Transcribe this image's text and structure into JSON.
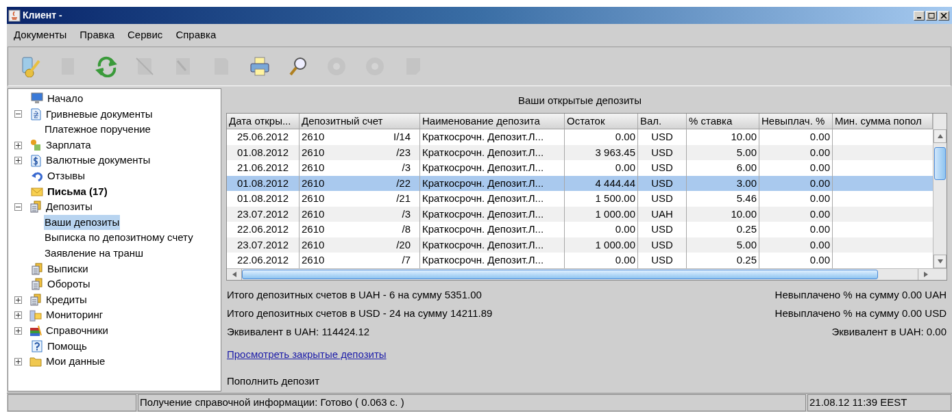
{
  "window": {
    "title": "Клиент -"
  },
  "menu": [
    "Документы",
    "Правка",
    "Сервис",
    "Справка"
  ],
  "toolbar": [
    {
      "kind": "key",
      "disabled": false
    },
    {
      "kind": "page",
      "disabled": true
    },
    {
      "kind": "refresh",
      "disabled": false
    },
    {
      "kind": "delete",
      "disabled": true
    },
    {
      "kind": "sign",
      "disabled": true
    },
    {
      "kind": "copy",
      "disabled": true
    },
    {
      "kind": "print",
      "disabled": false
    },
    {
      "kind": "search",
      "disabled": false
    },
    {
      "kind": "disc",
      "disabled": true
    },
    {
      "kind": "disc",
      "disabled": true
    },
    {
      "kind": "note",
      "disabled": true
    }
  ],
  "tree": [
    {
      "label": "Начало",
      "kind": "monitor",
      "selected": false
    },
    {
      "label": "Гривневые документы",
      "kind": "hryvnia",
      "expanded": true,
      "selected": false,
      "children": [
        {
          "label": "Платежное поручение",
          "selected": false
        }
      ]
    },
    {
      "label": "Зарплата",
      "kind": "people",
      "expanded": false,
      "selected": false
    },
    {
      "label": "Валютные документы",
      "kind": "dollar",
      "expanded": false,
      "selected": false
    },
    {
      "label": "Отзывы",
      "kind": "reply",
      "selected": false
    },
    {
      "label": "Письма (17)",
      "kind": "mail",
      "unread": true,
      "selected": false
    },
    {
      "label": "Депозиты",
      "kind": "stack",
      "expanded": true,
      "selected": false,
      "children": [
        {
          "label": "Ваши депозиты",
          "selected": true
        },
        {
          "label": "Выписка по депозитному счету",
          "selected": false
        },
        {
          "label": "Заявление на транш",
          "selected": false
        }
      ]
    },
    {
      "label": "Выписки",
      "kind": "stack",
      "selected": false
    },
    {
      "label": "Обороты",
      "kind": "stack",
      "selected": false
    },
    {
      "label": "Кредиты",
      "kind": "stack",
      "expanded": false,
      "selected": false
    },
    {
      "label": "Мониторинг",
      "kind": "monitoring",
      "expanded": false,
      "selected": false
    },
    {
      "label": "Справочники",
      "kind": "books",
      "expanded": false,
      "selected": false
    },
    {
      "label": "Помощь",
      "kind": "help",
      "selected": false
    },
    {
      "label": "Мои данные",
      "kind": "folder",
      "expanded": false,
      "selected": false
    }
  ],
  "panel_title": "Ваши открытые депозиты",
  "table": {
    "columns": [
      "Дата откры...",
      "Депозитный счет",
      "Наименование депозита",
      "Остаток",
      "Вал.",
      "% ставка",
      "Невыплач. %",
      "Мин. сумма попол"
    ],
    "rows": [
      {
        "date": "25.06.2012",
        "account": "2610",
        "account_suffix": "I/14",
        "name": "Краткосрочн. Депозит.Л...",
        "balance": "0.00",
        "currency": "USD",
        "rate": "10.00",
        "unpaid": "0.00",
        "selected": false
      },
      {
        "date": "01.08.2012",
        "account": "2610",
        "account_suffix": "/23",
        "name": "Краткосрочн. Депозит.Л...",
        "balance": "3 963.45",
        "currency": "USD",
        "rate": "5.00",
        "unpaid": "0.00",
        "selected": false
      },
      {
        "date": "21.06.2012",
        "account": "2610",
        "account_suffix": "/3",
        "name": "Краткосрочн. Депозит.Л...",
        "balance": "0.00",
        "currency": "USD",
        "rate": "6.00",
        "unpaid": "0.00",
        "selected": false
      },
      {
        "date": "01.08.2012",
        "account": "2610",
        "account_suffix": "/22",
        "name": "Краткосрочн. Депозит.Л...",
        "balance": "4 444.44",
        "currency": "USD",
        "rate": "3.00",
        "unpaid": "0.00",
        "selected": true
      },
      {
        "date": "01.08.2012",
        "account": "2610",
        "account_suffix": "/21",
        "name": "Краткосрочн. Депозит.Л...",
        "balance": "1 500.00",
        "currency": "USD",
        "rate": "5.46",
        "unpaid": "0.00",
        "selected": false
      },
      {
        "date": "23.07.2012",
        "account": "2610",
        "account_suffix": "/3",
        "name": "Краткосрочн. Депозит.Л...",
        "balance": "1 000.00",
        "currency": "UAH",
        "rate": "10.00",
        "unpaid": "0.00",
        "selected": false
      },
      {
        "date": "22.06.2012",
        "account": "2610",
        "account_suffix": "/8",
        "name": "Краткосрочн. Депозит.Л...",
        "balance": "0.00",
        "currency": "USD",
        "rate": "0.25",
        "unpaid": "0.00",
        "selected": false
      },
      {
        "date": "23.07.2012",
        "account": "2610",
        "account_suffix": "/20",
        "name": "Краткосрочн. Депозит.Л...",
        "balance": "1 000.00",
        "currency": "USD",
        "rate": "5.00",
        "unpaid": "0.00",
        "selected": false
      },
      {
        "date": "22.06.2012",
        "account": "2610",
        "account_suffix": "/7",
        "name": "Краткосрочн. Депозит.Л...",
        "balance": "0.00",
        "currency": "USD",
        "rate": "0.25",
        "unpaid": "0.00",
        "selected": false
      }
    ]
  },
  "summary": [
    {
      "left": "Итого депозитных счетов в UAH - 6 на сумму 5351.00",
      "right": "Невыплачено % на сумму 0.00 UAH"
    },
    {
      "left": "Итого депозитных счетов в USD - 24 на сумму 14211.89",
      "right": "Невыплачено % на сумму 0.00 USD"
    },
    {
      "left": "Эквивалент в UAH: 114424.12",
      "right": "Эквивалент в UAH: 0.00"
    }
  ],
  "closed_link": "Просмотреть закрытые депозиты",
  "top_up": "Пополнить депозит",
  "status_bar": {
    "message": "Получение справочной информации: Готово ( 0.063 с. )",
    "time": "21.08.12 11:39 EEST"
  }
}
